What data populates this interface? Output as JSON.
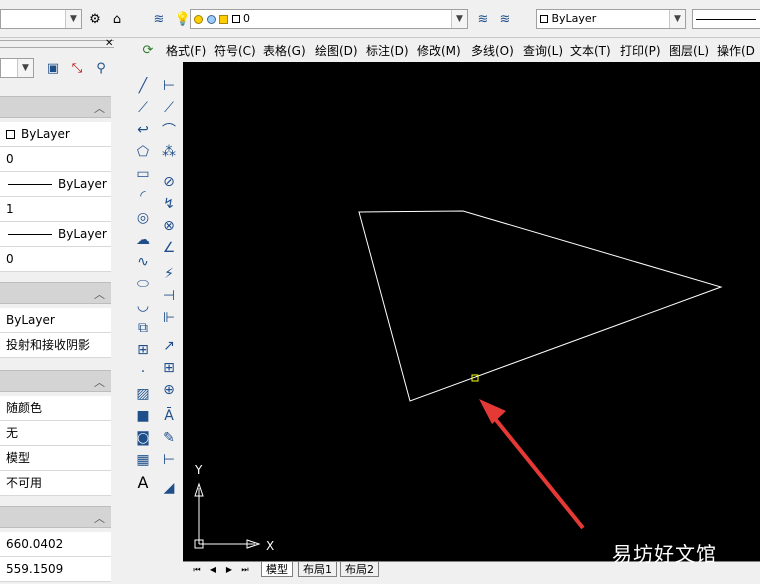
{
  "toolbar": {
    "layer_combo_value": "0",
    "color_combo_value": "ByLayer"
  },
  "menu": {
    "items": [
      "格式(F)",
      "符号(C)",
      "表格(G)",
      "绘图(D)",
      "标注(D)",
      "修改(M)",
      "多线(O)",
      "查询(L)",
      "文本(T)",
      "打印(P)",
      "图层(L)",
      "操作(D"
    ]
  },
  "properties": {
    "general": [
      "ByLayer",
      "0",
      "ByLayer",
      "1",
      "ByLayer",
      "0"
    ],
    "material": [
      "ByLayer",
      "投射和接收阴影"
    ],
    "plot": [
      "随颜色",
      "无",
      "模型",
      "不可用"
    ],
    "geometry": [
      "660.0402",
      "559.1509"
    ]
  },
  "canvas": {
    "ucs_y": "Y",
    "ucs_x": "X"
  },
  "tabs": [
    "模型",
    "布局1",
    "布局2"
  ],
  "watermark": "易坊好文馆",
  "colors": {
    "canvas_bg": "#000000",
    "geometry_line": "#ffffff",
    "grip": "#ffff00",
    "arrow": "#e53935"
  }
}
